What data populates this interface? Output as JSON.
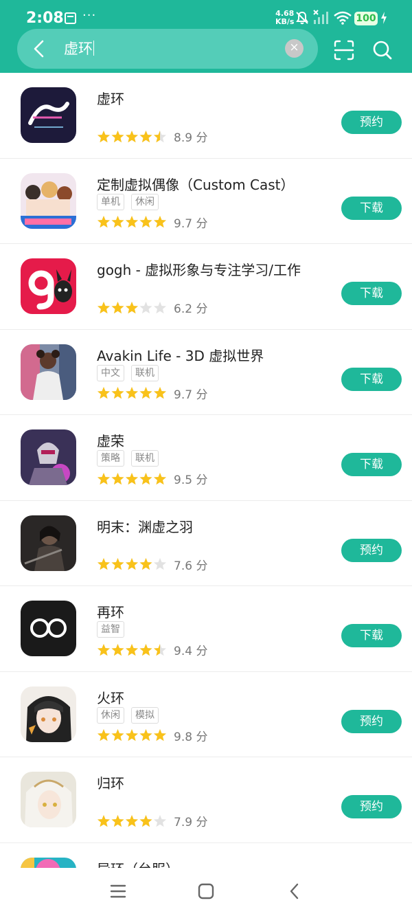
{
  "status_bar": {
    "time": "2:08",
    "net_speed_value": "4.68",
    "net_speed_unit": "KB/s",
    "more_indicator": "···",
    "battery": "100"
  },
  "search": {
    "query": "虚环",
    "clear_label": "×"
  },
  "results": [
    {
      "title": "虚环",
      "tags": [],
      "score": "8.9 分",
      "rating": 4.5,
      "action": "预约",
      "icon": "logo-text"
    },
    {
      "title": "定制虚拟偶像（Custom Cast）",
      "tags": [
        "单机",
        "休闲"
      ],
      "score": "9.7 分",
      "rating": 5,
      "action": "下载",
      "icon": "anime-girls"
    },
    {
      "title": "gogh - 虚拟形象与专注学习/工作",
      "tags": [],
      "score": "6.2 分",
      "rating": 3,
      "action": "下载",
      "icon": "gogh-logo"
    },
    {
      "title": "Avakin Life - 3D 虚拟世界",
      "tags": [
        "中文",
        "联机"
      ],
      "score": "9.7 分",
      "rating": 5,
      "action": "下载",
      "icon": "avatar-character"
    },
    {
      "title": "虚荣",
      "tags": [
        "策略",
        "联机"
      ],
      "score": "9.5 分",
      "rating": 5,
      "action": "下载",
      "icon": "robot-warrior"
    },
    {
      "title": "明末：渊虚之羽",
      "tags": [],
      "score": "7.6 分",
      "rating": 4,
      "action": "预约",
      "icon": "dark-warrior"
    },
    {
      "title": "再环",
      "tags": [
        "益智"
      ],
      "score": "9.4 分",
      "rating": 4.5,
      "action": "下载",
      "icon": "infinity-logo"
    },
    {
      "title": "火环",
      "tags": [
        "休闲",
        "模拟"
      ],
      "score": "9.8 分",
      "rating": 5,
      "action": "预约",
      "icon": "anime-character"
    },
    {
      "title": "归环",
      "tags": [],
      "score": "7.9 分",
      "rating": 4,
      "action": "预约",
      "icon": "white-hair-girl"
    },
    {
      "title": "异环（台服）",
      "tags": [],
      "score": "",
      "rating": 0,
      "action": "",
      "icon": "colorful-art"
    }
  ],
  "colors": {
    "accent": "#1fb89a",
    "star_filled": "#f9c21a",
    "star_empty": "#e2e2e2"
  }
}
